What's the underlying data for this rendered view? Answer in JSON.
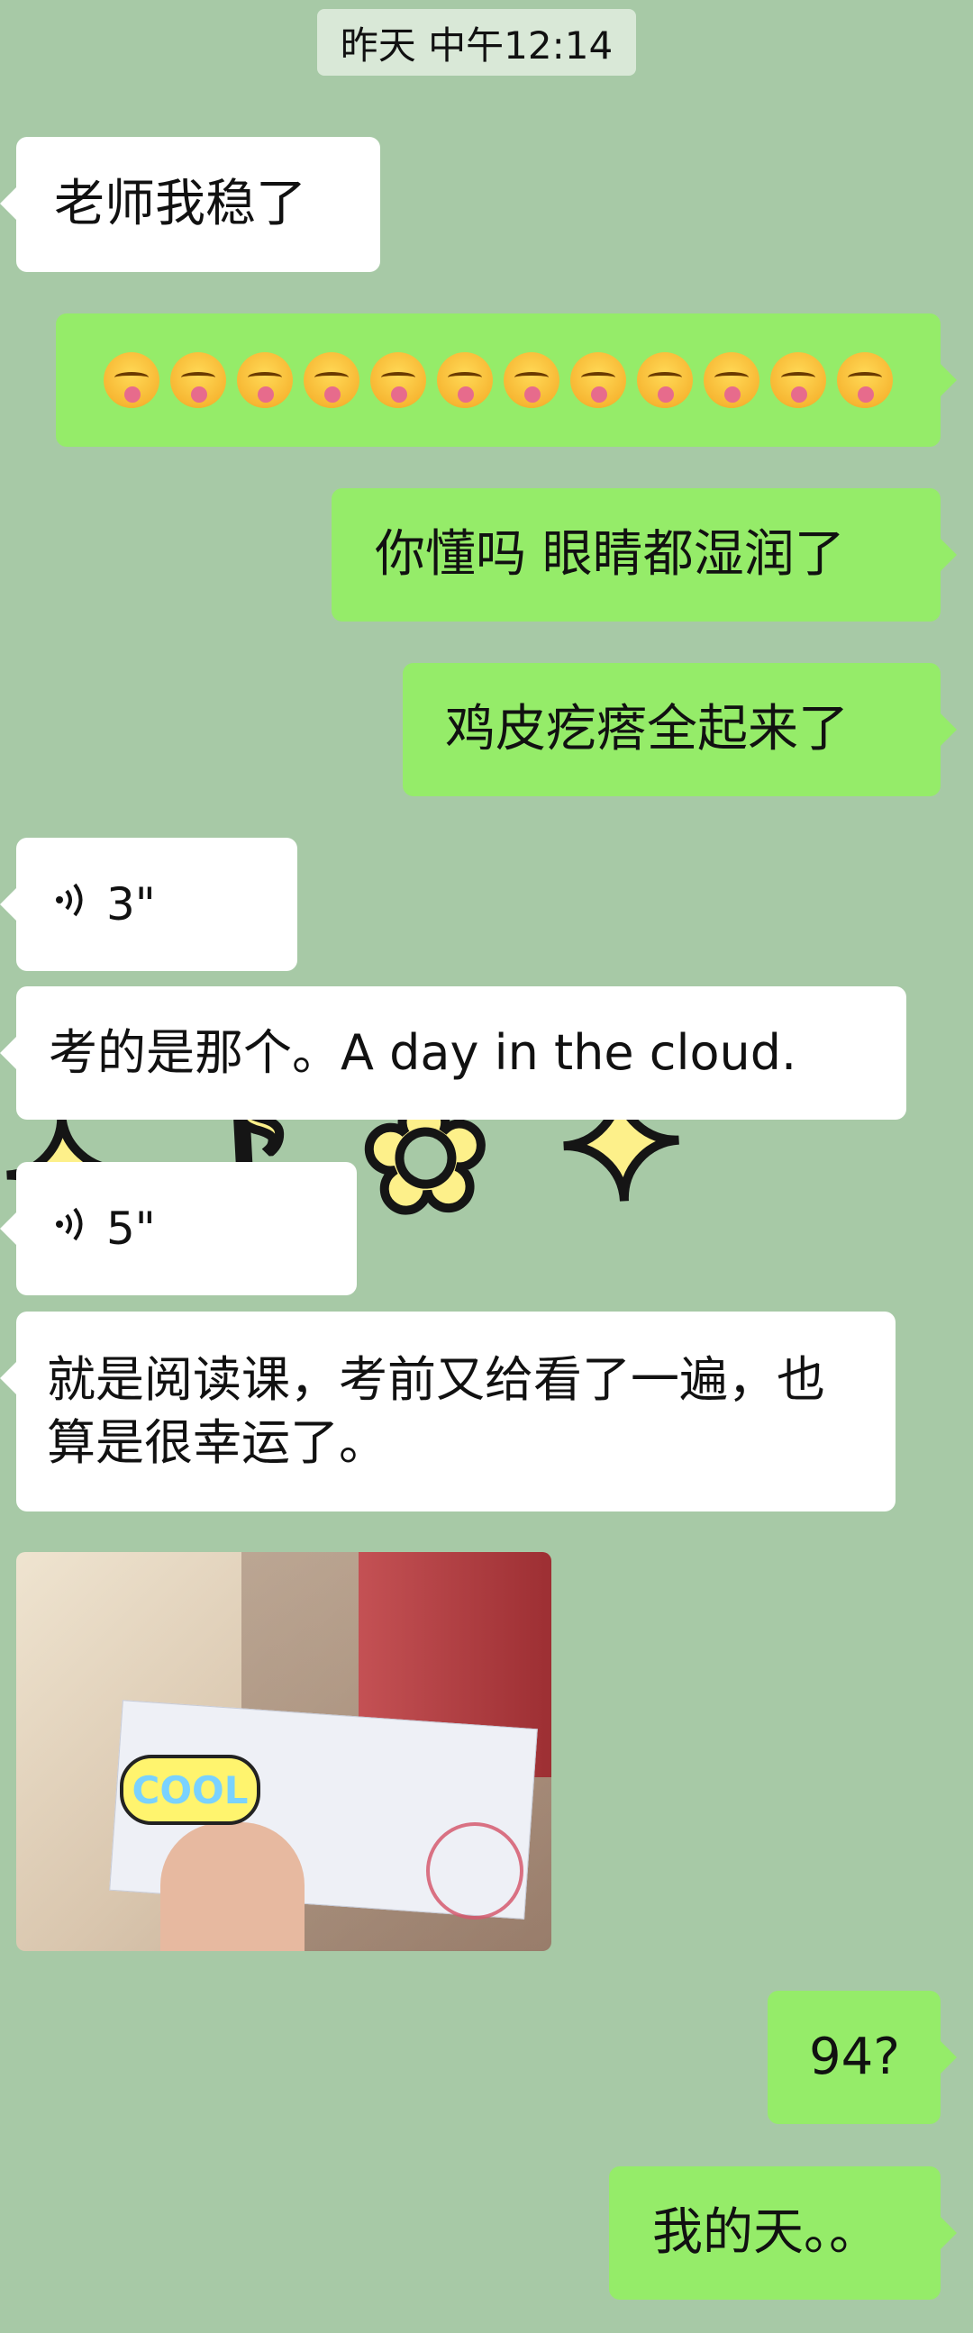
{
  "timestamp": "昨天 中午12:14",
  "messages": [
    {
      "side": "left",
      "text": "老师我稳了"
    },
    {
      "side": "right",
      "emoji": "yum-emoji",
      "count": 12
    },
    {
      "side": "right",
      "text": "你懂吗 眼睛都湿润了"
    },
    {
      "side": "right",
      "text": "鸡皮疙瘩全起来了"
    },
    {
      "side": "left",
      "voice": "3\""
    },
    {
      "side": "left",
      "text": "考的是那个。A day in the cloud."
    },
    {
      "side": "left",
      "voice": "5\""
    },
    {
      "side": "left",
      "text": "就是阅读课，考前又给看了一遍，也算是很幸运了。"
    },
    {
      "side": "left",
      "image_sticker": "COOL"
    },
    {
      "side": "right",
      "text": "94?"
    },
    {
      "side": "right",
      "text": "我的天。。"
    }
  ],
  "colors": {
    "background": "#a7c9a6",
    "incoming_bubble": "#ffffff",
    "outgoing_bubble": "#95ec69"
  }
}
